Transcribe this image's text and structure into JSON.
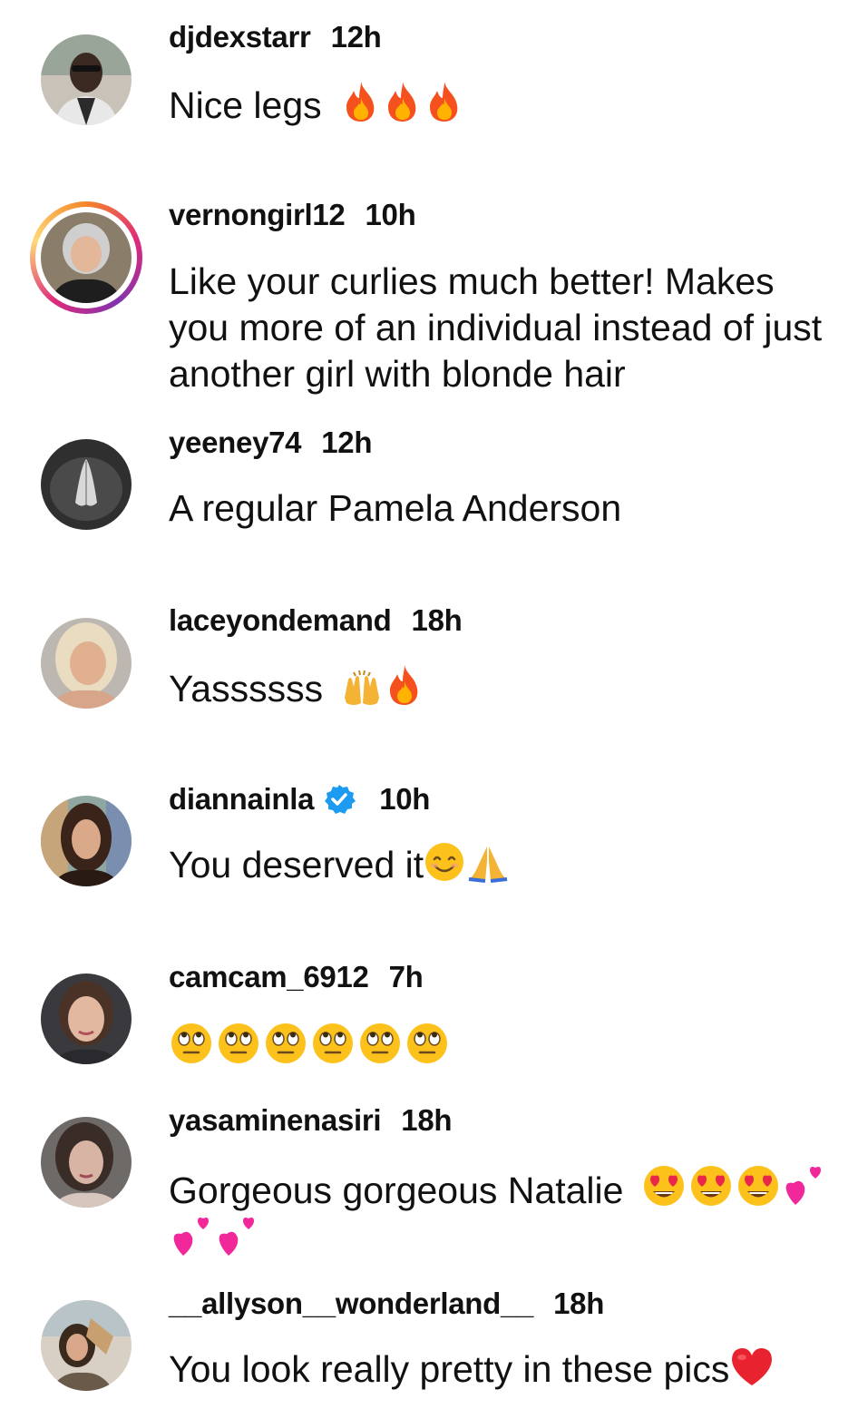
{
  "comments": [
    {
      "username": "djdexstarr",
      "time": "12h",
      "text": "Nice legs",
      "emojis": [
        "fire",
        "fire",
        "fire"
      ]
    },
    {
      "username": "vernongirl12",
      "time": "10h",
      "text": "Like your curlies much better!  Makes you more of an individual instead of just another girl with blonde hair",
      "emojis": [],
      "has_story_ring": true
    },
    {
      "username": "yeeney74",
      "time": "12h",
      "text": "A regular Pamela Anderson",
      "emojis": []
    },
    {
      "username": "laceyondemand",
      "time": "18h",
      "text": "Yassssss",
      "emojis": [
        "raising-hands",
        "fire"
      ]
    },
    {
      "username": "diannainla",
      "time": "10h",
      "text": "You deserved it",
      "emojis": [
        "smiling-face",
        "folded-hands"
      ],
      "verified": true
    },
    {
      "username": "camcam_6912",
      "time": "7h",
      "text": "",
      "emojis": [
        "eye-roll",
        "eye-roll",
        "eye-roll",
        "eye-roll",
        "eye-roll",
        "eye-roll"
      ]
    },
    {
      "username": "yasaminenasiri",
      "time": "18h",
      "text": "Gorgeous gorgeous Natalie",
      "emojis": [
        "heart-eyes",
        "heart-eyes",
        "heart-eyes",
        "two-hearts",
        "two-hearts",
        "two-hearts"
      ]
    },
    {
      "username": "__allyson__wonderland__",
      "time": "18h",
      "text": "You look really pretty in these pics",
      "emojis": [
        "red-heart"
      ]
    }
  ],
  "colors": {
    "text": "#111111",
    "verified_blue": "#1d9bf0",
    "story_ring": [
      "#f58529",
      "#dd2a7b",
      "#8134af"
    ]
  }
}
